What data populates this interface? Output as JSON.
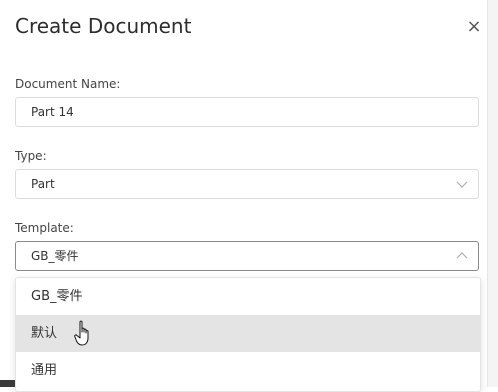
{
  "dialog": {
    "title": "Create Document",
    "close_glyph": "×"
  },
  "document_name": {
    "label": "Document Name:",
    "value": "Part 14"
  },
  "type": {
    "label": "Type:",
    "value": "Part"
  },
  "template": {
    "label": "Template:",
    "value": "GB_零件",
    "options": [
      {
        "label": "GB_零件"
      },
      {
        "label": "默认"
      },
      {
        "label": "通用"
      }
    ]
  },
  "icons": {
    "close": "close-icon",
    "type_chevron": "chevron-down-icon",
    "template_chevron": "chevron-up-icon",
    "cursor": "hand-pointer-icon"
  },
  "colors": {
    "hover_option_bg": "#e4e4e4",
    "border": "#dcdcdc",
    "active_border": "#8a8a8a"
  }
}
